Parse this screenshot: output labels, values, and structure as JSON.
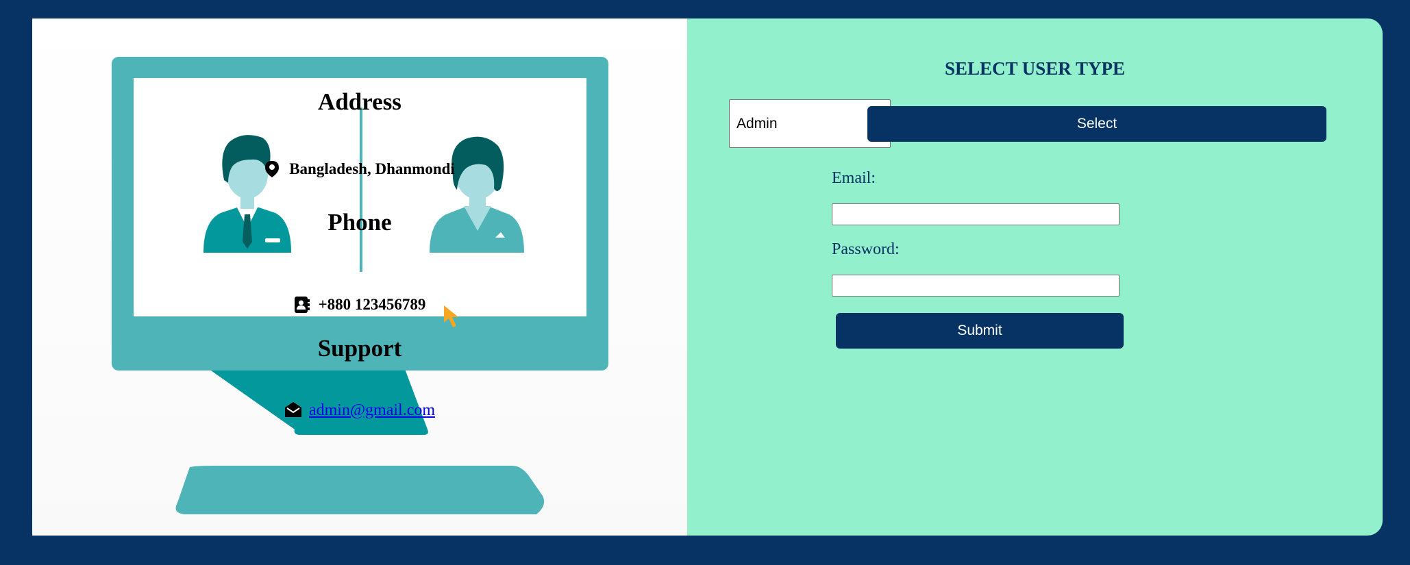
{
  "contact": {
    "address_heading": "Address",
    "address_text": "Bangladesh, Dhanmondi",
    "phone_heading": "Phone",
    "phone_text": "+880 123456789",
    "support_heading": "Support",
    "support_email": "admin@gmail.com"
  },
  "icons": {
    "address": "map-pin-icon",
    "phone": "address-book-icon",
    "support": "envelope-open-icon"
  },
  "form": {
    "title": "SELECT USER TYPE",
    "user_type_selected": "Admin",
    "select_button_label": "Select",
    "email_label": "Email:",
    "email_value": "",
    "password_label": "Password:",
    "password_value": "",
    "submit_button_label": "Submit"
  },
  "colors": {
    "background": "#063264",
    "form_panel": "#92f0cc",
    "accent": "#063264",
    "monitor": "#4eb4b7",
    "monitor_dark": "#03989b",
    "cursor": "#f5a623"
  }
}
